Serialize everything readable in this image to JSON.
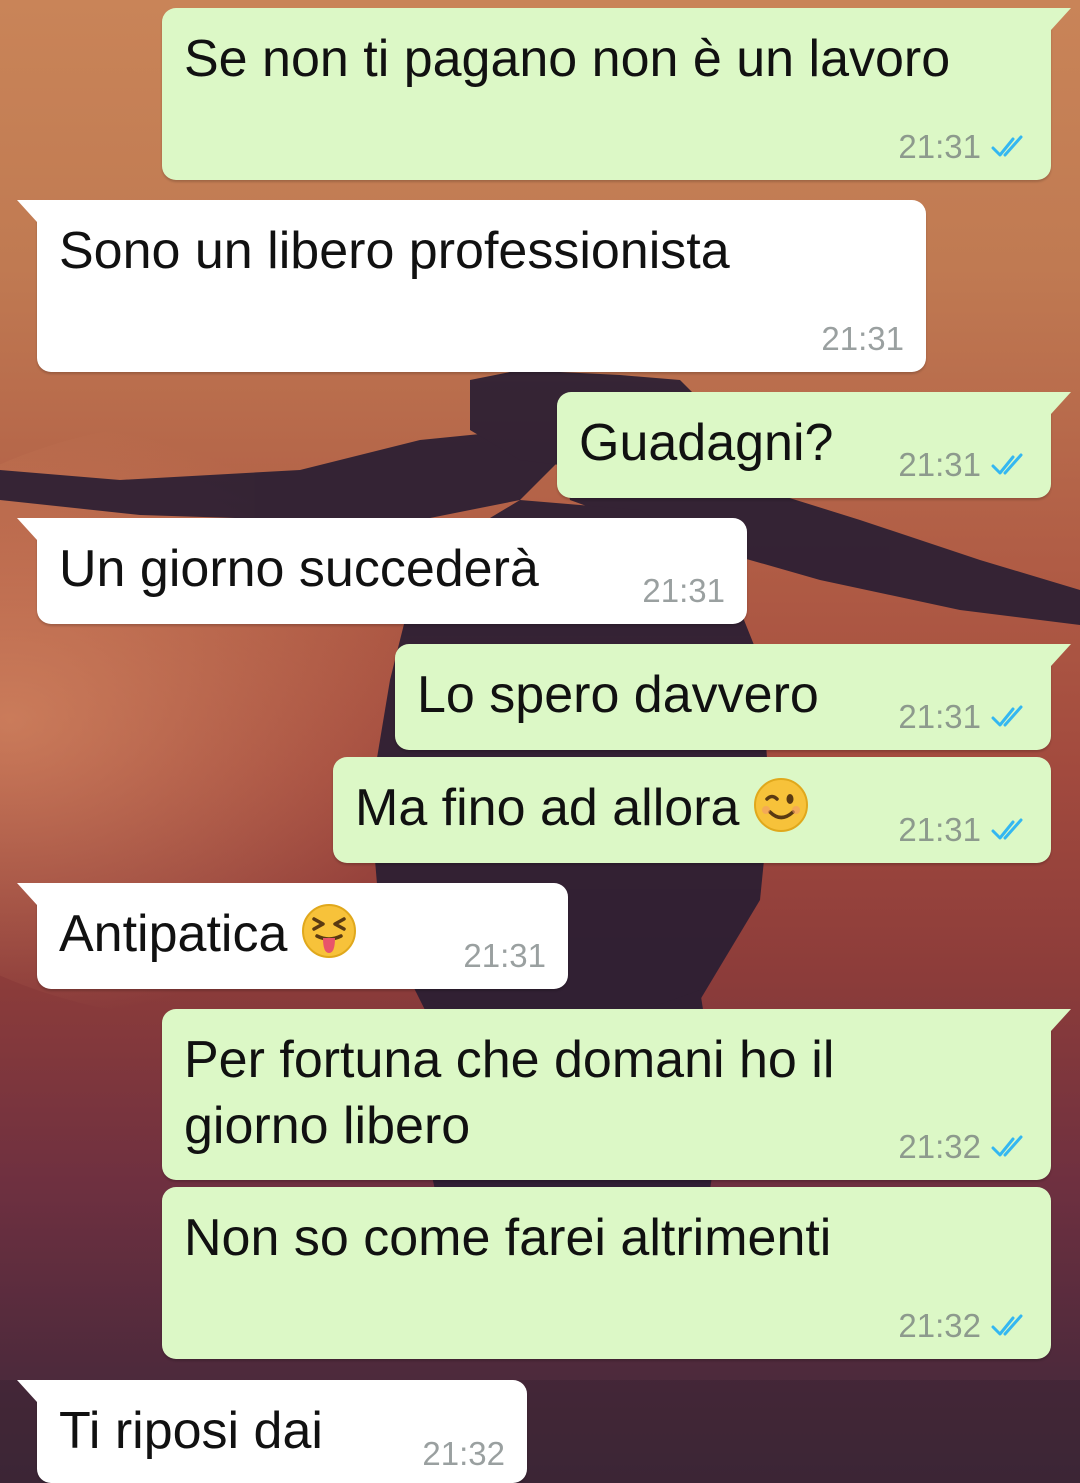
{
  "colors": {
    "outgoing_bubble": "#dcf8c6",
    "incoming_bubble": "#ffffff",
    "read_ticks": "#34b7f1",
    "timestamp": "#8d9a8d"
  },
  "messages": [
    {
      "direction": "outgoing",
      "text": "Se non ti pagano non è un lavoro",
      "time": "21:31",
      "status_icon": "double-check-read-icon"
    },
    {
      "direction": "incoming",
      "text": "Sono un libero professionista",
      "time": "21:31"
    },
    {
      "direction": "outgoing",
      "text": "Guadagni?",
      "time": "21:31",
      "status_icon": "double-check-read-icon"
    },
    {
      "direction": "incoming",
      "text": "Un giorno succederà",
      "time": "21:31"
    },
    {
      "direction": "outgoing",
      "text": "Lo spero davvero",
      "time": "21:31",
      "status_icon": "double-check-read-icon"
    },
    {
      "direction": "outgoing",
      "text": "Ma fino ad allora",
      "emoji": "winking-face-emoji",
      "time": "21:31",
      "status_icon": "double-check-read-icon"
    },
    {
      "direction": "incoming",
      "text": "Antipatica",
      "emoji": "squinting-face-with-tongue-emoji",
      "time": "21:31"
    },
    {
      "direction": "outgoing",
      "text_line1": "Per fortuna che domani ho il",
      "text_line2": "giorno libero",
      "time": "21:32",
      "status_icon": "double-check-read-icon"
    },
    {
      "direction": "outgoing",
      "text": "Non so come farei altrimenti",
      "time": "21:32",
      "status_icon": "double-check-read-icon"
    },
    {
      "direction": "incoming",
      "text": "Ti riposi dai",
      "time": "21:32"
    }
  ]
}
